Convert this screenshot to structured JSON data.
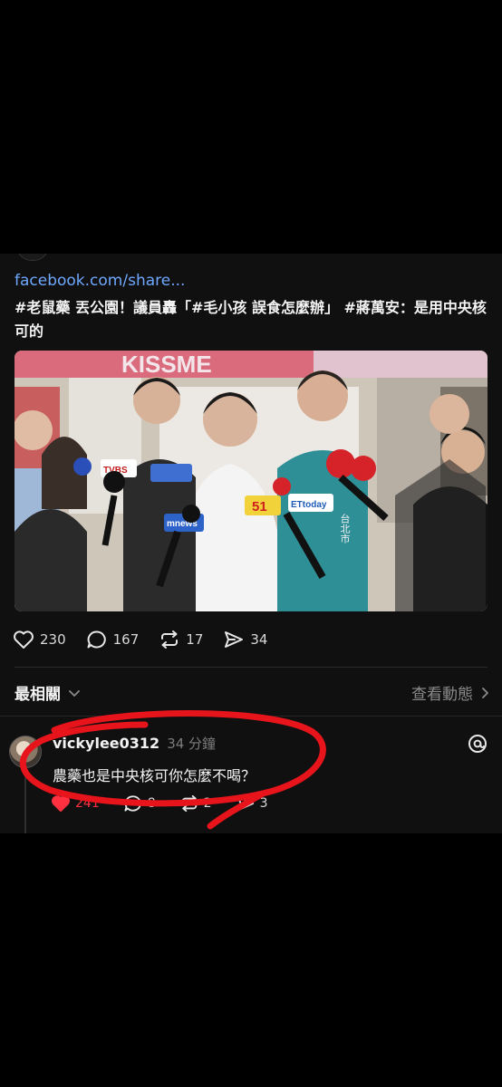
{
  "post": {
    "link_text": "facebook.com/share...",
    "text": "#老鼠藥 丟公園！議員轟「#毛小孩 誤食怎麼辦」 #蔣萬安：是用中央核可的",
    "photo_mic_labels": [
      "51",
      "ETtoday",
      "TVBS",
      "mnews",
      "台北市"
    ],
    "store_sign": "KISSME",
    "stats": {
      "likes": "230",
      "comments": "167",
      "reposts": "17",
      "shares": "34"
    }
  },
  "replies_header": {
    "sort_label": "最相關",
    "activity_link": "查看動態"
  },
  "comment": {
    "username": "vickylee0312",
    "time": "34 分鐘",
    "text": "農藥也是中央核可你怎麼不喝？",
    "likes": "241",
    "replies": "8",
    "reposts": "2",
    "shares": "3"
  },
  "colors": {
    "background": "#101010",
    "link": "#6ea8fe",
    "like_active": "#ff3040",
    "annotation": "#e8141b"
  }
}
